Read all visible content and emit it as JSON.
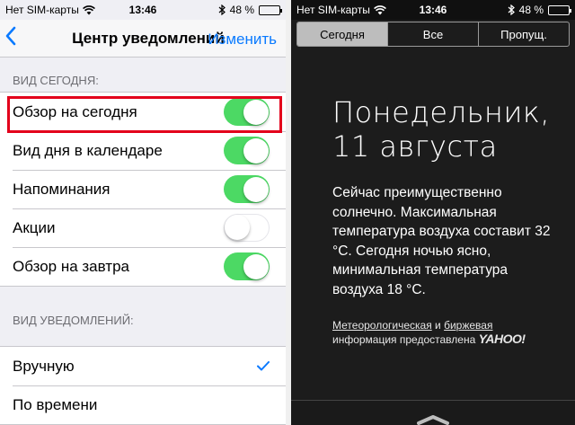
{
  "left": {
    "status": {
      "carrier": "Нет SIM-карты",
      "time": "13:46",
      "battery": "48 %",
      "battery_level": 0.48
    },
    "nav": {
      "back_icon": "chevron-left",
      "title": "Центр уведомлений",
      "edit_label": "Изменить"
    },
    "section_today": {
      "header": "ВИД СЕГОДНЯ:",
      "items": [
        {
          "label": "Обзор на сегодня",
          "on": true
        },
        {
          "label": "Вид дня в календаре",
          "on": true
        },
        {
          "label": "Напоминания",
          "on": true
        },
        {
          "label": "Акции",
          "on": false
        },
        {
          "label": "Обзор на завтра",
          "on": true
        }
      ]
    },
    "section_notifications": {
      "header": "ВИД УВЕДОМЛЕНИЙ:",
      "items": [
        {
          "label": "Вручную",
          "checked": true
        },
        {
          "label": "По времени",
          "checked": false
        }
      ]
    },
    "accent_color": "#0a7aff",
    "toggle_on_color": "#4cd964",
    "highlight_color": "#e3001b"
  },
  "right": {
    "status": {
      "carrier": "Нет SIM-карты",
      "time": "13:46",
      "battery": "48 %",
      "battery_level": 0.48
    },
    "tabs": [
      {
        "label": "Сегодня",
        "active": true
      },
      {
        "label": "Все",
        "active": false
      },
      {
        "label": "Пропущ.",
        "active": false
      }
    ],
    "date_line1": "Понедельник,",
    "date_line2": "11 августа",
    "weather_text": "Сейчас преимущественно солнечно. Максимальная температура воздуха составит 32 °C. Сегодня ночью ясно, минимальная температура воздуха 18 °C.",
    "attribution": {
      "link1": "Метеорологическая",
      "and": "и",
      "link2": "биржевая",
      "text": "информация предоставлена",
      "brand": "YAHOO!"
    }
  }
}
